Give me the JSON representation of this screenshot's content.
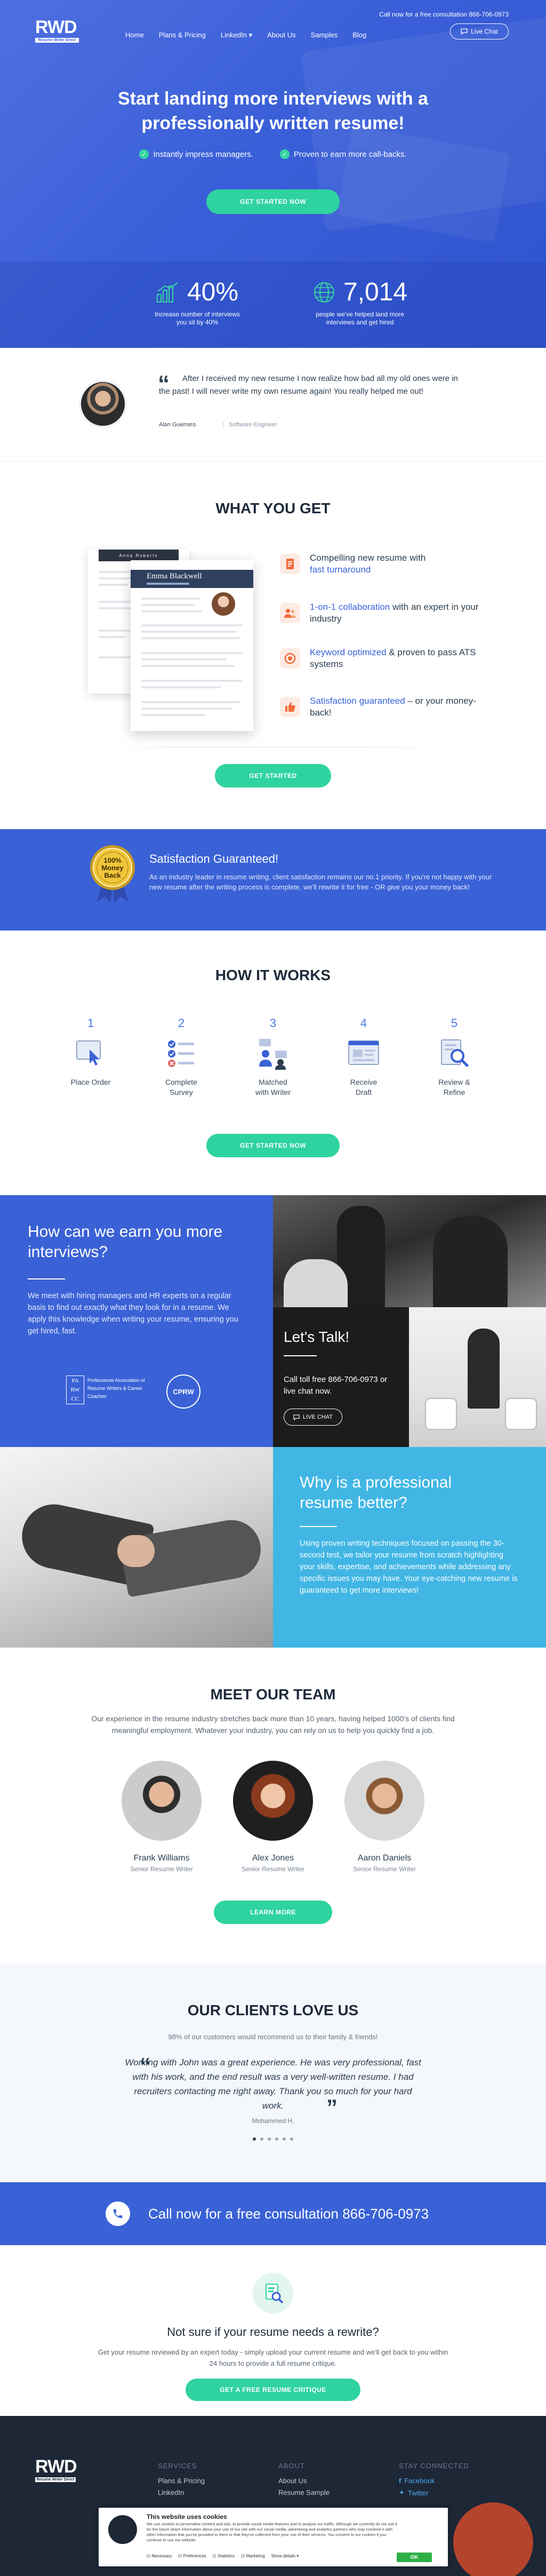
{
  "header": {
    "logo_text": "RWD",
    "logo_sub": "Resume Writer Direct",
    "top_call": "Call now for a free consultation 866-706-0973",
    "nav": [
      "Home",
      "Plans & Pricing",
      "LinkedIn",
      "About Us",
      "Samples",
      "Blog"
    ],
    "live_chat": "Live Chat"
  },
  "hero": {
    "title_line1": "Start landing more interviews with a",
    "title_line2": "professionally written resume!",
    "checks": [
      "Instantly impress managers.",
      "Proven to earn more call-backs."
    ],
    "cta": "GET STARTED NOW",
    "stats": [
      {
        "value": "40%",
        "label_line1": "Increase number of interviews",
        "label_line2": "you sit by 40%"
      },
      {
        "value": "7,014",
        "label_line1": "people we've helped land more",
        "label_line2": "interviews and get hired"
      }
    ]
  },
  "testimonial": {
    "quote": "After I received my new resume I now realize how bad all my old ones were in the past! I will never write my own resume again! You really helped me out!",
    "name": "Alan Guerrero",
    "role": "Software Engineer"
  },
  "what_you_get": {
    "title": "WHAT YOU GET",
    "resume_name": "Emma Blackwell",
    "resume_back_name": "Anna Roberts",
    "items": [
      {
        "pre": "Compelling new resume with",
        "hl": "fast turnaround",
        "post": ""
      },
      {
        "pre": "",
        "hl": "1-on-1 collaboration",
        "post": " with an expert in your industry"
      },
      {
        "pre": "",
        "hl": "Keyword optimized",
        "post": " & proven to pass ATS systems"
      },
      {
        "pre": "",
        "hl": "Satisfaction guaranteed",
        "post": " – or your money-back!"
      }
    ],
    "cta": "GET STARTED"
  },
  "satisfaction": {
    "badge_l1": "100%",
    "badge_l2": "Money",
    "badge_l3": "Back",
    "title": "Satisfaction Guaranteed!",
    "text": "As an industry leader in resume writing, client satisfaction remains our no.1 priority. If you're not happy with your new resume after the writing process is complete, we'll rewrite it for free - OR give you your money back!"
  },
  "how_it_works": {
    "title": "HOW IT WORKS",
    "steps": [
      {
        "num": "1",
        "l1": "Place Order",
        "l2": ""
      },
      {
        "num": "2",
        "l1": "Complete",
        "l2": "Survey"
      },
      {
        "num": "3",
        "l1": "Matched",
        "l2": "with Writer"
      },
      {
        "num": "4",
        "l1": "Receive",
        "l2": "Draft"
      },
      {
        "num": "5",
        "l1": "Review &",
        "l2": "Refine"
      }
    ],
    "cta": "GET STARTED NOW"
  },
  "earn": {
    "title": "How can we earn you more interviews?",
    "text": "We meet with hiring managers and HR experts on a regular basis to find out exactly what they look for in a resume. We apply this knowledge when writing your resume, ensuring you get hired, fast.",
    "logo1_text": "PA RW CC",
    "logo1_caption": "Professional Association of Resume Writers & Career Coaches",
    "logo2_text": "CPRW"
  },
  "talk": {
    "title": "Let's Talk!",
    "text": "Call toll free 866-706-0973 or live chat now.",
    "button": "LIVE CHAT"
  },
  "why": {
    "title": "Why is a professional resume better?",
    "text": "Using proven writing techniques focused on passing the 30-second test, we tailor your resume from scratch highlighting your skills, expertise, and achievements while addressing any specific issues you may have. Your eye-catching new resume is guaranteed to get more interviews!"
  },
  "team": {
    "title": "MEET OUR TEAM",
    "intro": "Our experience in the resume industry stretches back more than 10 years, having helped 1000's of clients find meaningful employment. Whatever your industry, you can rely on us to help you quickly find a job.",
    "members": [
      {
        "name": "Frank Williams",
        "role": "Senior Resume Writer"
      },
      {
        "name": "Alex Jones",
        "role": "Senior Resume Writer"
      },
      {
        "name": "Aaron Daniels",
        "role": "Senior Resume Writer"
      }
    ],
    "cta": "LEARN MORE"
  },
  "clients": {
    "title": "OUR CLIENTS LOVE US",
    "subtitle": "98% of our customers would recommend us to their family & friends!",
    "quote": "Working with John was a great experience. He was very professional, fast with his work, and the end result was a very well-written resume. I had recruiters contacting me right away. Thank you so much for your hard work.",
    "author": "Mohammed H."
  },
  "callband": {
    "text": "Call now for a free consultation 866-706-0973"
  },
  "critique": {
    "title": "Not sure if your resume needs a rewrite?",
    "text": "Get your resume reviewed by an expert today - simply upload your current resume and we'll get back to you within 24 hours to provide a full resume critique.",
    "cta": "GET A FREE RESUME CRITIQUE"
  },
  "footer": {
    "col1_title": "SERVICES",
    "col1_links": [
      "Plans & Pricing",
      "LinkedIn"
    ],
    "col2_title": "ABOUT",
    "col2_links": [
      "About Us",
      "Resume Sample"
    ],
    "col3_title": "STAY CONNECTED",
    "social": [
      "Facebook",
      "Twitter"
    ]
  },
  "cookie": {
    "title": "This website uses cookies",
    "body": "We use cookies to personalise content and ads, to provide social media features and to analyse our traffic. Although we currently do not use it for the future share information about your use of our site with our social media, advertising and analytics partners who may combine it with other information that you've provided to them or that they've collected from your use of their services. You consent to our cookies if you continue to use our website.",
    "options": [
      "Necessary",
      "Preferences",
      "Statistics",
      "Marketing",
      "Show details"
    ],
    "ok": "OK"
  },
  "colors": {
    "primary_blue": "#3a62d6",
    "accent_green": "#2fd3a0",
    "accent_cyan": "#41b6e4",
    "footer_dark": "#1d2736"
  }
}
